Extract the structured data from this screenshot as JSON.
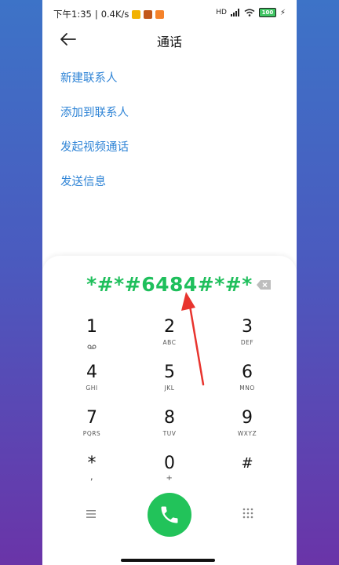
{
  "status_bar": {
    "time": "下午1:35",
    "separator": "|",
    "speed": "0.4K/s",
    "battery": "100",
    "hd_label": "HD",
    "colors": {
      "app1": "#f2b200",
      "app2": "#c2571a",
      "app3": "#f5822a"
    }
  },
  "header": {
    "title": "通话",
    "back_icon": "back-arrow-icon"
  },
  "menu": {
    "items": [
      {
        "label": "新建联系人"
      },
      {
        "label": "添加到联系人"
      },
      {
        "label": "发起视频通话"
      },
      {
        "label": "发送信息"
      }
    ]
  },
  "dialer": {
    "number": "*#*#6484#*#*",
    "keys": [
      {
        "digit": "1",
        "sub": "voicemail-icon"
      },
      {
        "digit": "2",
        "sub": "ABC"
      },
      {
        "digit": "3",
        "sub": "DEF"
      },
      {
        "digit": "4",
        "sub": "GHI"
      },
      {
        "digit": "5",
        "sub": "JKL"
      },
      {
        "digit": "6",
        "sub": "MNO"
      },
      {
        "digit": "7",
        "sub": "PQRS"
      },
      {
        "digit": "8",
        "sub": "TUV"
      },
      {
        "digit": "9",
        "sub": "WXYZ"
      },
      {
        "digit": "*",
        "sub": ","
      },
      {
        "digit": "0",
        "sub": "+"
      },
      {
        "digit": "#",
        "sub": ""
      }
    ],
    "call_icon": "phone-icon",
    "menu_icon": "menu-icon",
    "keypad_icon": "keypad-grid-icon",
    "delete_icon": "backspace-icon"
  },
  "annotation": {
    "arrow_color": "#e8342e"
  },
  "colors": {
    "accent": "#2f84d6",
    "green": "#22c35a",
    "number_green": "#1fbf5c"
  }
}
